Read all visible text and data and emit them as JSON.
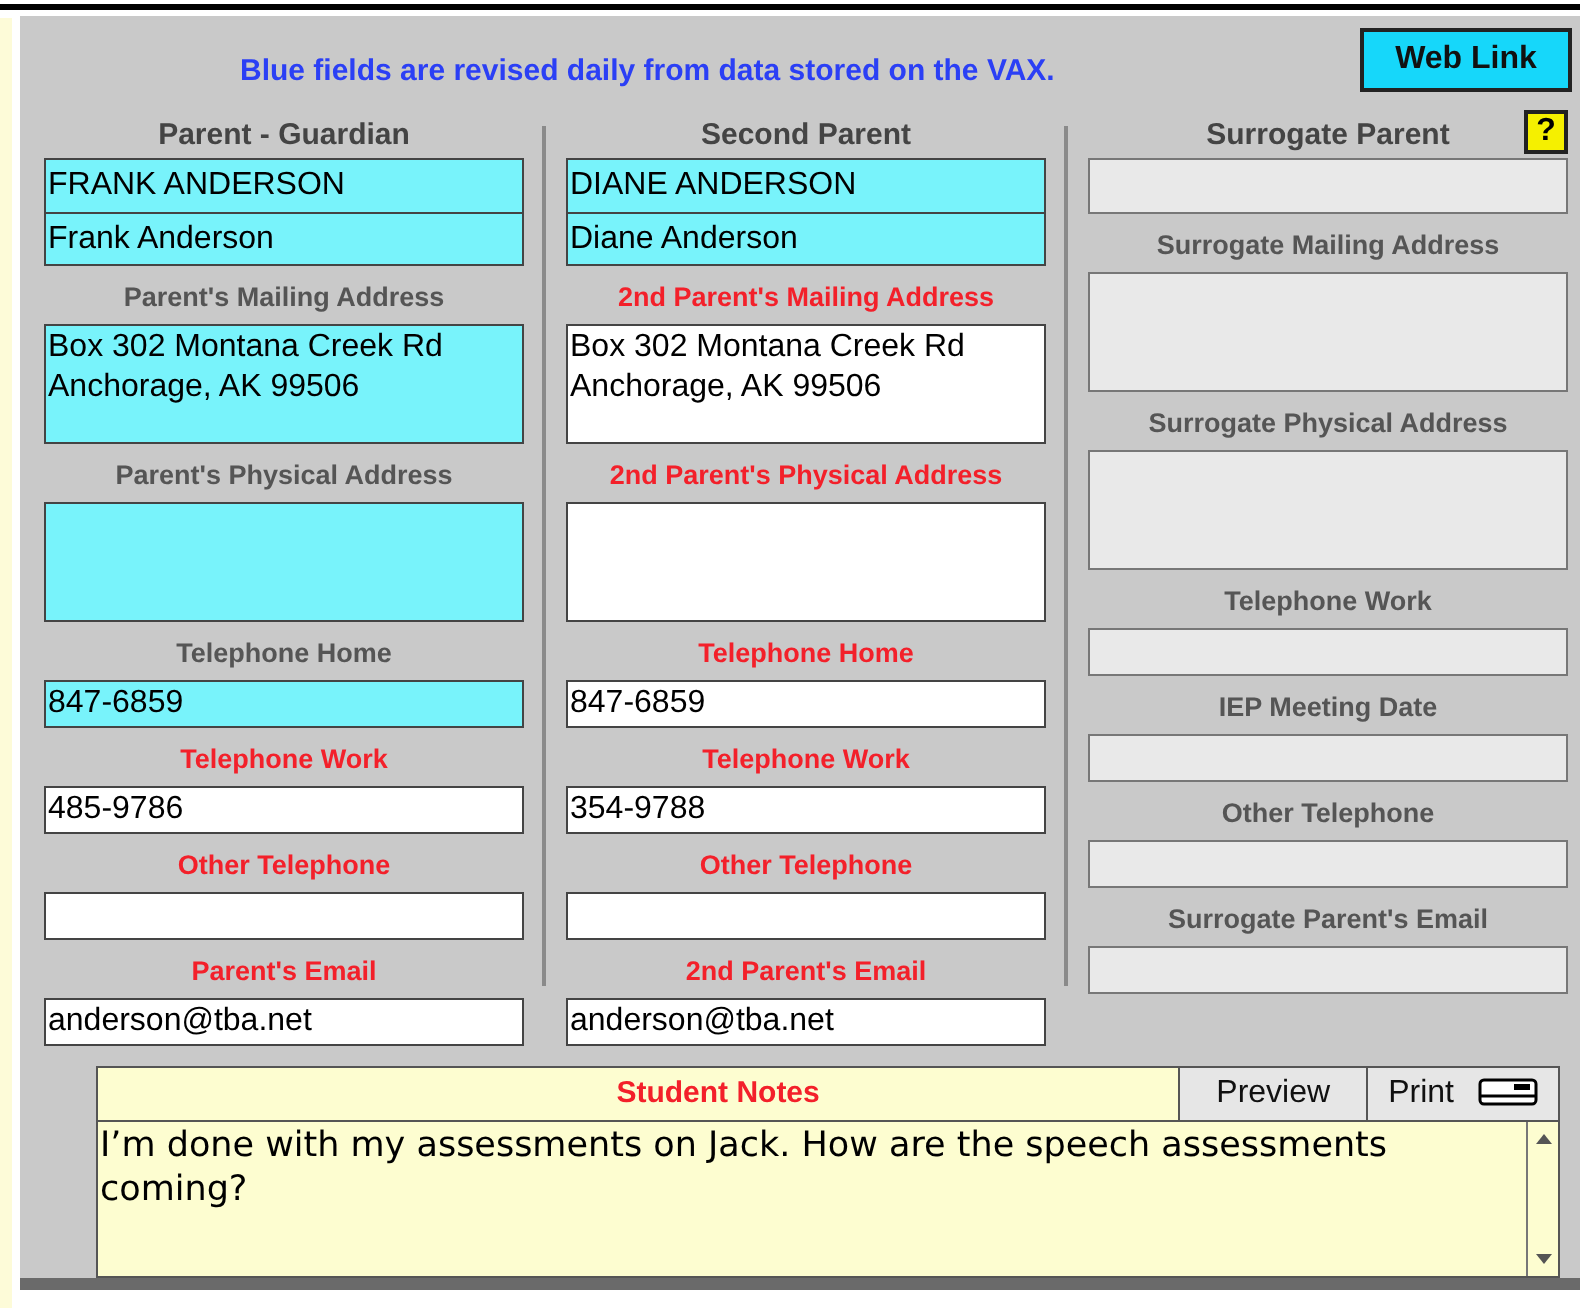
{
  "banner": "Blue fields are revised daily from data stored on the VAX.",
  "web_link": "Web Link",
  "help_button": "?",
  "columns": [
    {
      "heading": "Parent - Guardian",
      "fields": [
        {
          "kind": "line",
          "synced": true,
          "disabled": false,
          "value": "FRANK ANDERSON"
        },
        {
          "kind": "line",
          "synced": true,
          "disabled": false,
          "value": "Frank Anderson"
        },
        {
          "kind": "area",
          "label": "Parent's Mailing Address",
          "required": false,
          "synced": true,
          "disabled": false,
          "lines": [
            "Box 302 Montana Creek Rd",
            "Anchorage, AK 99506"
          ]
        },
        {
          "kind": "area",
          "label": "Parent's Physical Address",
          "required": false,
          "synced": true,
          "disabled": false
        },
        {
          "kind": "line",
          "label": "Telephone Home",
          "required": false,
          "synced": true,
          "disabled": false,
          "value": "847-6859"
        },
        {
          "kind": "line",
          "label": "Telephone Work",
          "required": true,
          "synced": false,
          "disabled": false,
          "value": "485-9786"
        },
        {
          "kind": "line",
          "label": "Other Telephone",
          "required": true,
          "synced": false,
          "disabled": false
        },
        {
          "kind": "line",
          "label": "Parent's Email",
          "required": true,
          "synced": false,
          "disabled": false,
          "value": "anderson@tba.net"
        }
      ]
    },
    {
      "heading": "Second Parent",
      "fields": [
        {
          "kind": "line",
          "synced": true,
          "disabled": false,
          "value": "DIANE ANDERSON"
        },
        {
          "kind": "line",
          "synced": true,
          "disabled": false,
          "value": "Diane Anderson"
        },
        {
          "kind": "area",
          "label": "2nd Parent's Mailing Address",
          "required": true,
          "synced": false,
          "disabled": false,
          "lines": [
            "Box 302 Montana Creek Rd",
            "Anchorage, AK 99506"
          ]
        },
        {
          "kind": "area",
          "label": "2nd Parent's Physical Address",
          "required": true,
          "synced": false,
          "disabled": false
        },
        {
          "kind": "line",
          "label": "Telephone Home",
          "required": true,
          "synced": false,
          "disabled": false,
          "value": "847-6859"
        },
        {
          "kind": "line",
          "label": "Telephone Work",
          "required": true,
          "synced": false,
          "disabled": false,
          "value": "354-9788"
        },
        {
          "kind": "line",
          "label": "Other Telephone",
          "required": true,
          "synced": false,
          "disabled": false
        },
        {
          "kind": "line",
          "label": "2nd Parent's Email",
          "required": true,
          "synced": false,
          "disabled": false,
          "value": "anderson@tba.net"
        }
      ]
    },
    {
      "heading": "Surrogate Parent",
      "fields": [
        {
          "kind": "name",
          "disabled": true
        },
        {
          "kind": "area",
          "label": "Surrogate Mailing Address",
          "required": false,
          "disabled": true
        },
        {
          "kind": "area",
          "label": "Surrogate Physical Address",
          "required": false,
          "disabled": true
        },
        {
          "kind": "line",
          "label": "Telephone Work",
          "required": false,
          "disabled": true
        },
        {
          "kind": "line",
          "label": "IEP Meeting Date",
          "required": false,
          "disabled": true
        },
        {
          "kind": "line",
          "label": "Other Telephone",
          "required": false,
          "disabled": true
        },
        {
          "kind": "line",
          "label": "Surrogate Parent's Email",
          "required": false,
          "disabled": true
        }
      ]
    }
  ],
  "notes": {
    "title": "Student Notes",
    "buttons": [
      "Preview",
      "Print"
    ],
    "text": "I’m done with my assessments on Jack. How are the speech assessments coming?"
  }
}
